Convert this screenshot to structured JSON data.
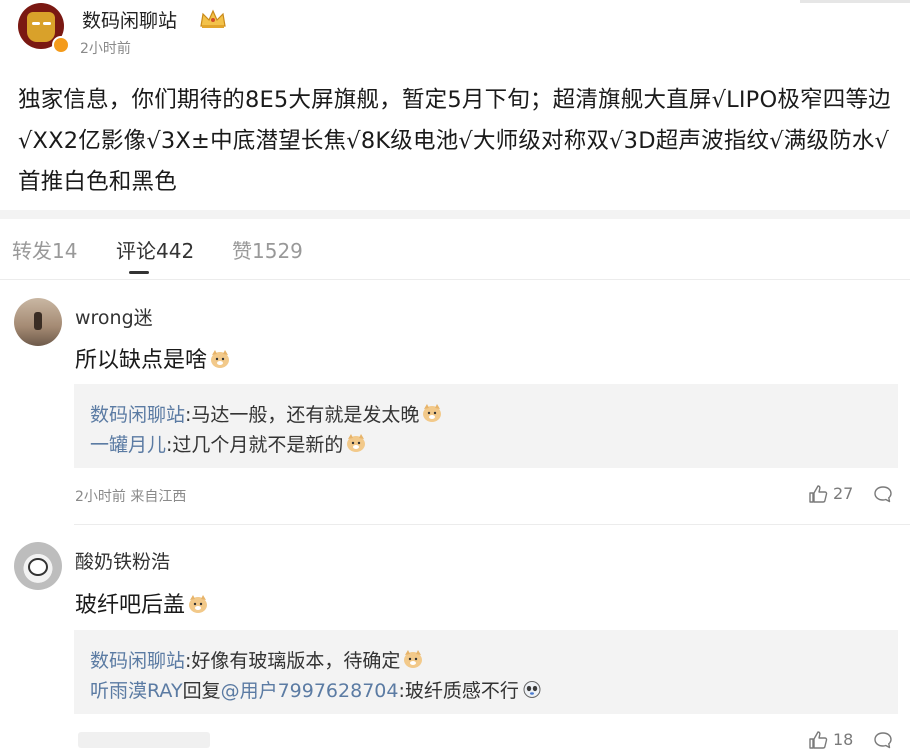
{
  "post": {
    "author": "数码闲聊站",
    "time": "2小时前",
    "text": "独家信息，你们期待的8E5大屏旗舰，暂定5月下旬；超清旗舰大直屏√LIPO极窄四等边√XX2亿影像√3X±中底潜望长焦√8K级电池√大师级对称双√3D超声波指纹√满级防水√首推白色和黑色"
  },
  "tabs": {
    "repost": "转发14",
    "comments": "评论442",
    "likes": "赞1529"
  },
  "comments": [
    {
      "user": "wrong迷",
      "text": "所以缺点是啥",
      "replies": [
        {
          "user": "数码闲聊站",
          "text": ":马达一般，还有就是发太晚"
        },
        {
          "user": "一罐月儿",
          "text": ":过几个月就不是新的"
        }
      ],
      "meta": "2小时前 来自江西",
      "likes": "27"
    },
    {
      "user": "酸奶铁粉浩",
      "text": "玻纤吧后盖",
      "replies": [
        {
          "user": "数码闲聊站",
          "text": ":好像有玻璃版本，待确定"
        },
        {
          "user": "听雨漠RAY",
          "mid": "回复",
          "mention": "@用户7997628704",
          "text": ":玻纤质感不行"
        }
      ],
      "likes": "18"
    }
  ],
  "icons": {
    "verified": "verified-badge-icon",
    "crown": "crown-icon",
    "emoji": "doge-emoji-icon",
    "like": "thumbs-up-icon",
    "comment": "comment-bubble-icon"
  },
  "colors": {
    "link": "#5b7ba3",
    "muted": "#8a8a8a",
    "badge": "#f49b1b"
  }
}
